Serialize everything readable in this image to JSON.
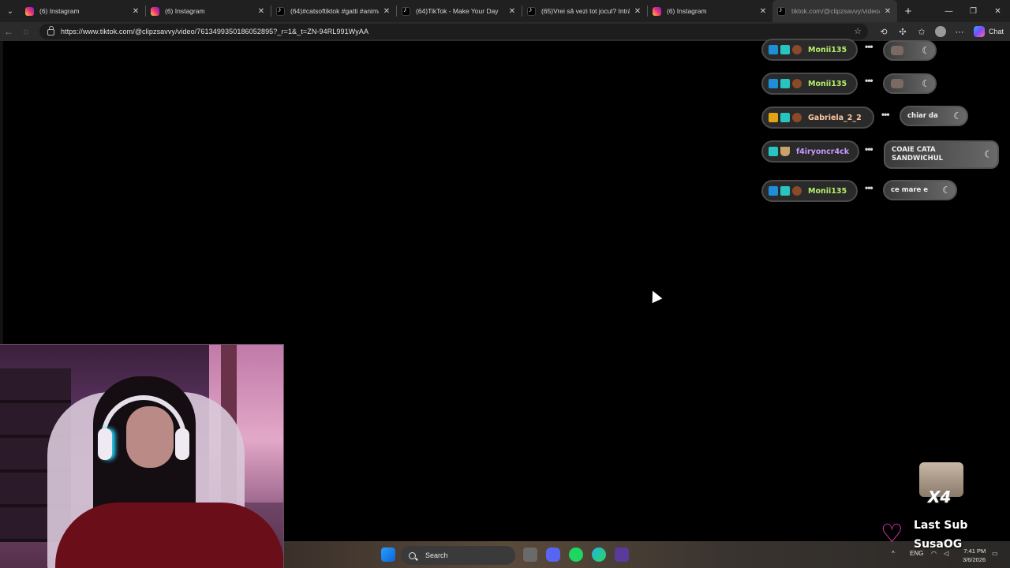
{
  "browser": {
    "tabs": [
      {
        "title": "(6) Instagram",
        "favicon": "instagram-icon"
      },
      {
        "title": "(6) Instagram",
        "favicon": "instagram-icon"
      },
      {
        "title": "(64)#catsoftiktok #gatti #animalfu",
        "favicon": "tiktok-icon"
      },
      {
        "title": "(64)TikTok - Make Your Day",
        "favicon": "tiktok-icon"
      },
      {
        "title": "(65)Vrei să vezi tot jocul? Intră pe",
        "favicon": "tiktok-icon"
      },
      {
        "title": "(6) Instagram",
        "favicon": "instagram-icon"
      },
      {
        "title": "tiktok.com/@clipzsavvy/video/76",
        "favicon": "tiktok-icon"
      }
    ],
    "url": "https://www.tiktok.com/@clipzsavvy/video/7613499350186052895?_r=1&_t=ZN-94RL991WyAA",
    "copilot_label": "Chat"
  },
  "chat": [
    {
      "user": "Monii135",
      "user_color": "#b6f06a",
      "message": "",
      "has_emote": true
    },
    {
      "user": "Monii135",
      "user_color": "#b6f06a",
      "message": "",
      "has_emote": true
    },
    {
      "user": "Gabriela_2_2",
      "user_color": "#ffc6a0",
      "message": "chiar da",
      "has_emote": false
    },
    {
      "user": "f4iryoncr4ck",
      "user_color": "#c89aff",
      "message": "COAIE CATA\nSANDWICHUL",
      "has_emote": false
    },
    {
      "user": "Monii135",
      "user_color": "#b6f06a",
      "message": "ce mare e",
      "has_emote": false
    }
  ],
  "alert": {
    "multiplier": "X4",
    "label": "Last Sub",
    "name": "SusaOG",
    "heart_color": "#ff3ec8"
  },
  "taskbar": {
    "search_label": "Search",
    "language": "ENG",
    "time": "7:41 PM",
    "date": "3/6/2026"
  }
}
